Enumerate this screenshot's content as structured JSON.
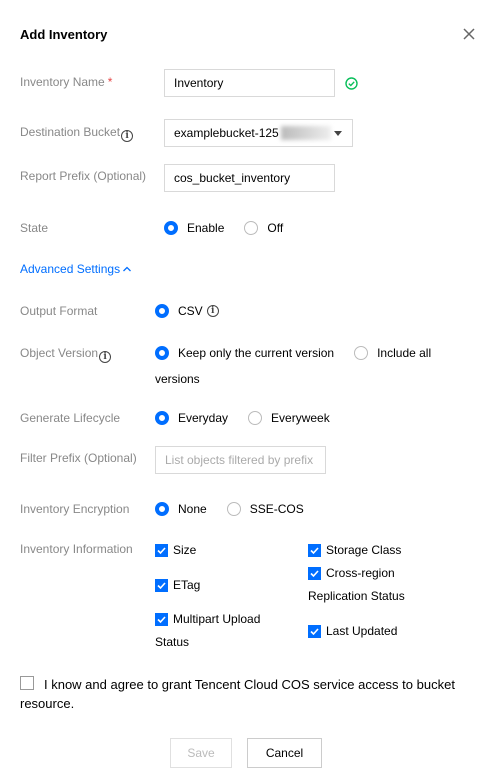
{
  "dialog": {
    "title": "Add Inventory"
  },
  "form": {
    "inventory_name": {
      "label": "Inventory Name",
      "required_mark": "*",
      "value": "Inventory"
    },
    "destination_bucket": {
      "label": "Destination Bucket",
      "value": "examplebucket-125"
    },
    "report_prefix": {
      "label": "Report Prefix (Optional)",
      "value": "cos_bucket_inventory"
    },
    "state": {
      "label": "State",
      "options": [
        "Enable",
        "Off"
      ],
      "selected": "Enable"
    },
    "advanced_settings": {
      "label": "Advanced Settings"
    },
    "output_format": {
      "label": "Output Format",
      "options": [
        "CSV"
      ],
      "selected": "CSV"
    },
    "object_version": {
      "label": "Object Version",
      "options": [
        "Keep only the current version",
        "Include all",
        "versions"
      ],
      "selected": "Keep only the current version"
    },
    "generate_lifecycle": {
      "label": "Generate Lifecycle",
      "options": [
        "Everyday",
        "Everyweek"
      ],
      "selected": "Everyday"
    },
    "filter_prefix": {
      "label": "Filter Prefix (Optional)",
      "placeholder": "List objects filtered by prefix"
    },
    "inventory_encryption": {
      "label": "Inventory Encryption",
      "options": [
        "None",
        "SSE-COS"
      ],
      "selected": "None"
    },
    "inventory_information": {
      "label": "Inventory Information",
      "items": [
        "Size",
        "ETag",
        "Multipart Upload",
        "Status",
        "Storage Class",
        "Cross-region",
        "Replication Status",
        "Last Updated"
      ],
      "checked": true
    },
    "agreement": {
      "line1": "I know and agree to grant Tencent Cloud COS service access to bucket",
      "line2": "resource.",
      "checked": false
    }
  },
  "footer": {
    "save_label": "Save",
    "cancel_label": "Cancel"
  },
  "colors": {
    "accent": "#006eff",
    "success": "#0abf5b",
    "required": "#e54545"
  },
  "icons": [
    "close-icon",
    "check-circle-icon",
    "info-icon",
    "chevron-up-icon",
    "dropdown-arrow-icon",
    "checkmark-icon"
  ]
}
